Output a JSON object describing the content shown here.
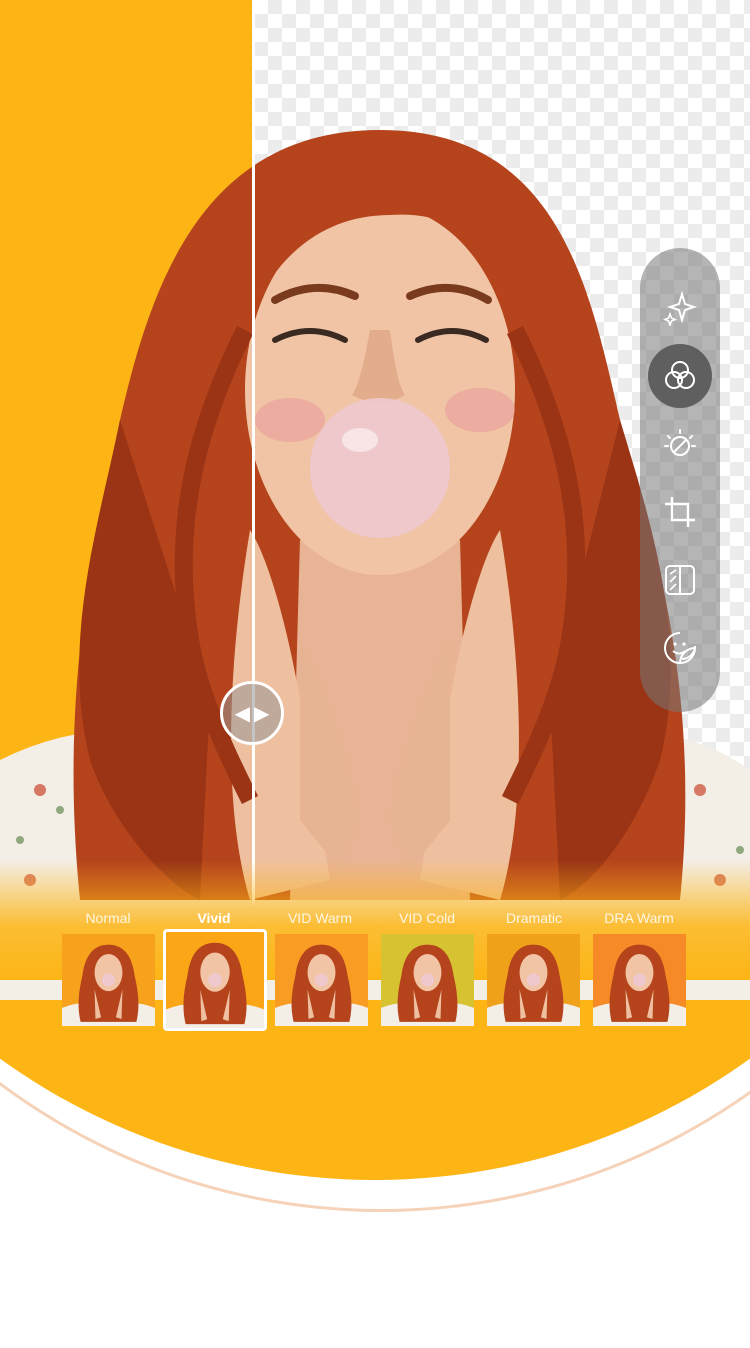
{
  "colors": {
    "accent": "#FDB515",
    "hair": "#B5441C",
    "skin": "#F1C4A5"
  },
  "compare": {
    "handle_icon": "left-right-arrows-icon"
  },
  "toolbar": [
    {
      "id": "magic",
      "icon": "sparkle-icon"
    },
    {
      "id": "filters",
      "icon": "overlapping-circles-icon",
      "active": true
    },
    {
      "id": "adjust",
      "icon": "brightness-icon"
    },
    {
      "id": "crop",
      "icon": "crop-icon"
    },
    {
      "id": "background",
      "icon": "background-swap-icon"
    },
    {
      "id": "sticker",
      "icon": "sticker-icon"
    }
  ],
  "filters": {
    "selected": "Vivid",
    "items": [
      {
        "label": "Normal",
        "tint": "#F7A21C"
      },
      {
        "label": "Vivid",
        "tint": "#FBA617"
      },
      {
        "label": "VID Warm",
        "tint": "#F99C23"
      },
      {
        "label": "VID Cold",
        "tint": "#D7C232"
      },
      {
        "label": "Dramatic",
        "tint": "#F0A11A"
      },
      {
        "label": "DRA Warm",
        "tint": "#F68A26"
      }
    ]
  }
}
